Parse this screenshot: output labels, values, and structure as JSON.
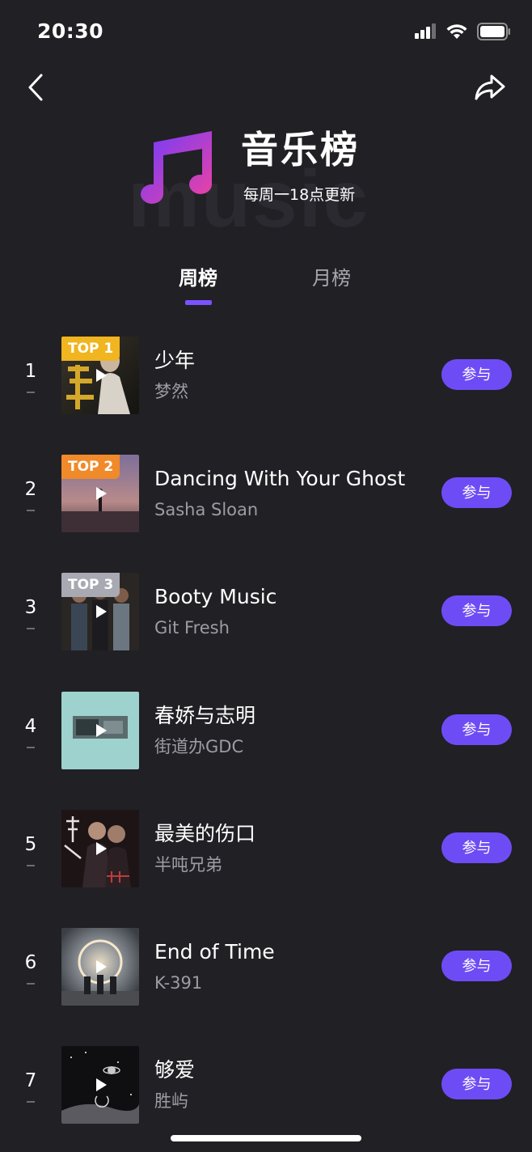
{
  "status_bar": {
    "time": "20:30"
  },
  "header": {
    "bg_text": "music",
    "title": "音乐榜",
    "subtitle": "每周一18点更新"
  },
  "tabs": [
    {
      "label": "周榜",
      "active": true
    },
    {
      "label": "月榜",
      "active": false
    }
  ],
  "colors": {
    "background": "#212025",
    "accent": "#6e4cf5",
    "top1_badge": "#f0b51f",
    "top2_badge": "#f08a2a",
    "top3_badge": "#a9a9b3"
  },
  "songs": [
    {
      "rank": "1",
      "badge": "TOP 1",
      "title": "少年",
      "artist": "梦然",
      "button": "参与"
    },
    {
      "rank": "2",
      "badge": "TOP 2",
      "title": "Dancing With Your Ghost",
      "artist": "Sasha Sloan",
      "button": "参与"
    },
    {
      "rank": "3",
      "badge": "TOP 3",
      "title": "Booty Music",
      "artist": "Git Fresh",
      "button": "参与"
    },
    {
      "rank": "4",
      "badge": "",
      "title": "春娇与志明",
      "artist": "街道办GDC",
      "button": "参与"
    },
    {
      "rank": "5",
      "badge": "",
      "title": "最美的伤口",
      "artist": "半吨兄弟",
      "button": "参与"
    },
    {
      "rank": "6",
      "badge": "",
      "title": "End of Time",
      "artist": "K-391",
      "button": "参与"
    },
    {
      "rank": "7",
      "badge": "",
      "title": "够爱",
      "artist": "胜屿",
      "button": "参与"
    }
  ]
}
